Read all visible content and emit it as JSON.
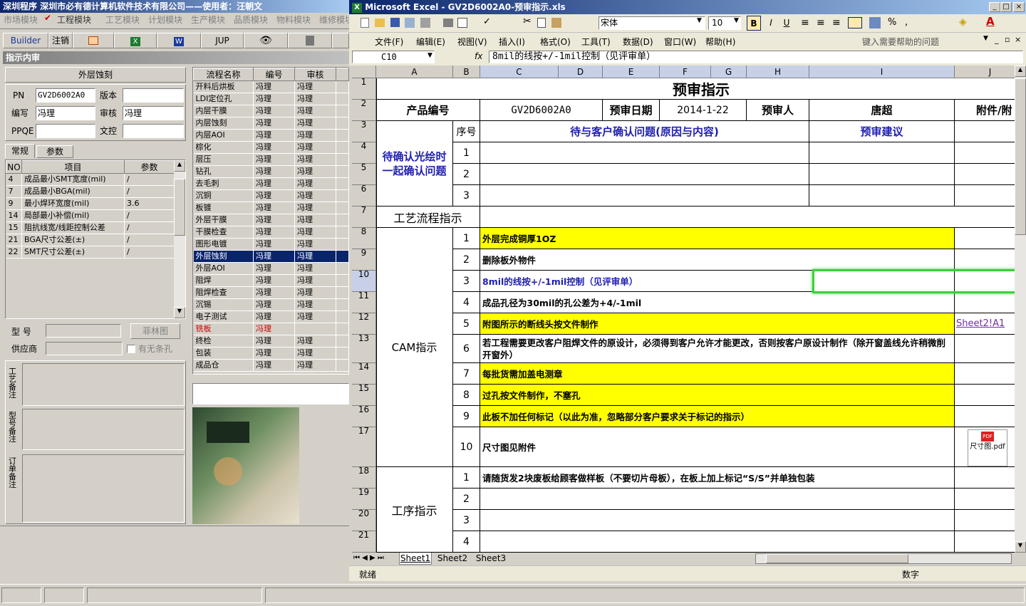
{
  "left": {
    "title": "深圳程序   深圳市必有德计算机软件技术有限公司——使用者：汪朝文",
    "menu": [
      "市场模块",
      "工程模块",
      "工艺模块",
      "计划模块",
      "生产模块",
      "品质模块",
      "物料模块",
      "维修模块"
    ],
    "toolbar": {
      "builder": "Builder",
      "cancel": "注销",
      "jup": "JUP"
    },
    "panel_title": "指示内审",
    "header_label": "外层蚀刻",
    "pn_label": "PN",
    "pn_value": "GV2D6002A0",
    "version_label": "版本",
    "author_label": "编写",
    "author_value": "冯理",
    "audit_label": "审核",
    "audit_value": "冯理",
    "ppqe_label": "PPQE",
    "control_label": "文控",
    "tabs": [
      "常规",
      "参数"
    ],
    "param_headers": [
      "NO",
      "项目",
      "参数"
    ],
    "params": [
      {
        "no": "4",
        "item": "成品最小SMT宽度(mil)",
        "value": "/"
      },
      {
        "no": "7",
        "item": "成品最小BGA(mil)",
        "value": "/"
      },
      {
        "no": "9",
        "item": "最小焊环宽度(mil)",
        "value": "3.6"
      },
      {
        "no": "14",
        "item": "局部最小补偿(mil)",
        "value": "/"
      },
      {
        "no": "15",
        "item": "阻抗线宽/线距控制公差",
        "value": "/"
      },
      {
        "no": "21",
        "item": "BGA尺寸公差(±)",
        "value": "/"
      },
      {
        "no": "22",
        "item": "SMT尺寸公差(±)",
        "value": "/"
      }
    ],
    "model_label": "型  号",
    "supplier_label": "供应商",
    "film_btn": "菲林图",
    "slot_check": "有无条孔",
    "note_labels": [
      "工艺备注",
      "型号备注",
      "订单备注"
    ],
    "flow_headers": [
      "流程名称",
      "编号",
      "审核"
    ],
    "flow": [
      [
        "开料后烘板",
        "冯理",
        "冯理"
      ],
      [
        "LDI定位孔",
        "冯理",
        "冯理"
      ],
      [
        "内层干膜",
        "冯理",
        "冯理"
      ],
      [
        "内层蚀刻",
        "冯理",
        "冯理"
      ],
      [
        "内层AOI",
        "冯理",
        "冯理"
      ],
      [
        "棕化",
        "冯理",
        "冯理"
      ],
      [
        "层压",
        "冯理",
        "冯理"
      ],
      [
        "钻孔",
        "冯理",
        "冯理"
      ],
      [
        "去毛刺",
        "冯理",
        "冯理"
      ],
      [
        "沉铜",
        "冯理",
        "冯理"
      ],
      [
        "板镀",
        "冯理",
        "冯理"
      ],
      [
        "外层干膜",
        "冯理",
        "冯理"
      ],
      [
        "干膜检查",
        "冯理",
        "冯理"
      ],
      [
        "图形电镀",
        "冯理",
        "冯理"
      ],
      [
        "外层蚀刻",
        "冯理",
        "冯理"
      ],
      [
        "外层AOI",
        "冯理",
        "冯理"
      ],
      [
        "阻焊",
        "冯理",
        "冯理"
      ],
      [
        "阻焊检查",
        "冯理",
        "冯理"
      ],
      [
        "沉锡",
        "冯理",
        "冯理"
      ],
      [
        "电子测试",
        "冯理",
        "冯理"
      ],
      [
        "铣板",
        "冯理",
        ""
      ],
      [
        "终检",
        "冯理",
        "冯理"
      ],
      [
        "包装",
        "冯理",
        "冯理"
      ],
      [
        "成品仓",
        "冯理",
        "冯理"
      ]
    ]
  },
  "excel": {
    "title": "Microsoft Excel - GV2D6002A0-预审指示.xls",
    "menu": [
      "文件(F)",
      "编辑(E)",
      "视图(V)",
      "插入(I)",
      "格式(O)",
      "工具(T)",
      "数据(D)",
      "窗口(W)",
      "帮助(H)"
    ],
    "help_placeholder": "键入需要帮助的问题",
    "font_name": "宋体",
    "font_size": "10",
    "name_box": "C10",
    "formula": "8mil的线按+/-1mil控制（见评审单）",
    "columns": [
      "A",
      "B",
      "C",
      "D",
      "E",
      "F",
      "G",
      "H",
      "I",
      "J"
    ],
    "rows": [
      "1",
      "2",
      "3",
      "4",
      "5",
      "6",
      "7",
      "8",
      "9",
      "10",
      "11",
      "12",
      "13",
      "14",
      "15",
      "16",
      "17",
      "18",
      "19",
      "20",
      "21"
    ],
    "sheet_title": "预审指示",
    "product_no_label": "产品编号",
    "product_no": "GV2D6002A0",
    "review_date_label": "预审日期",
    "review_date": "2014-1-22",
    "reviewer_label": "预审人",
    "reviewer": "唐超",
    "attachment_label": "附件/附",
    "seq_label": "序号",
    "confirm_header": "待与客户确认问题(原因与内容)",
    "advice_header": "预审建议",
    "pending_label": "待确认光绘时一起确认问题",
    "flow_label": "工艺流程指示",
    "cam_label": "CAM指示",
    "process_label": "工序指示",
    "confirm_seq": [
      "1",
      "2",
      "3"
    ],
    "cam_items": [
      {
        "n": "1",
        "t": "外层完成铜厚1OZ"
      },
      {
        "n": "2",
        "t": "删除板外物件"
      },
      {
        "n": "3",
        "t": "8mil的线按+/-1mil控制（见评审单）"
      },
      {
        "n": "4",
        "t": "成品孔径为30mil的孔公差为+4/-1mil"
      },
      {
        "n": "5",
        "t": "附图所示的断线头按文件制作"
      },
      {
        "n": "6",
        "t": "若工程需要更改客户阻焊文件的原设计，必须得到客户允许才能更改，否则按客户原设计制作（除开窗盖线允许稍微削开窗外）"
      },
      {
        "n": "7",
        "t": "每批货需加盖电测章"
      },
      {
        "n": "8",
        "t": "过孔按文件制作，不塞孔"
      },
      {
        "n": "9",
        "t": "此板不加任何标记（以此为准，忽略部分客户要求关于标记的指示）"
      },
      {
        "n": "10",
        "t": "尺寸图见附件"
      }
    ],
    "hyperlink": "Sheet2!A1",
    "attach_icon_label": "尺寸图.pdf",
    "process_items": [
      {
        "n": "1",
        "t": "请随货发2块废板给顾客做样板（不要切片母板），在板上加上标记“S/S”并单独包装"
      },
      {
        "n": "2",
        "t": ""
      },
      {
        "n": "3",
        "t": ""
      },
      {
        "n": "4",
        "t": ""
      }
    ],
    "sheet_tabs": [
      "Sheet1",
      "Sheet2",
      "Sheet3"
    ],
    "status_ready": "就绪",
    "status_num": "数字"
  }
}
